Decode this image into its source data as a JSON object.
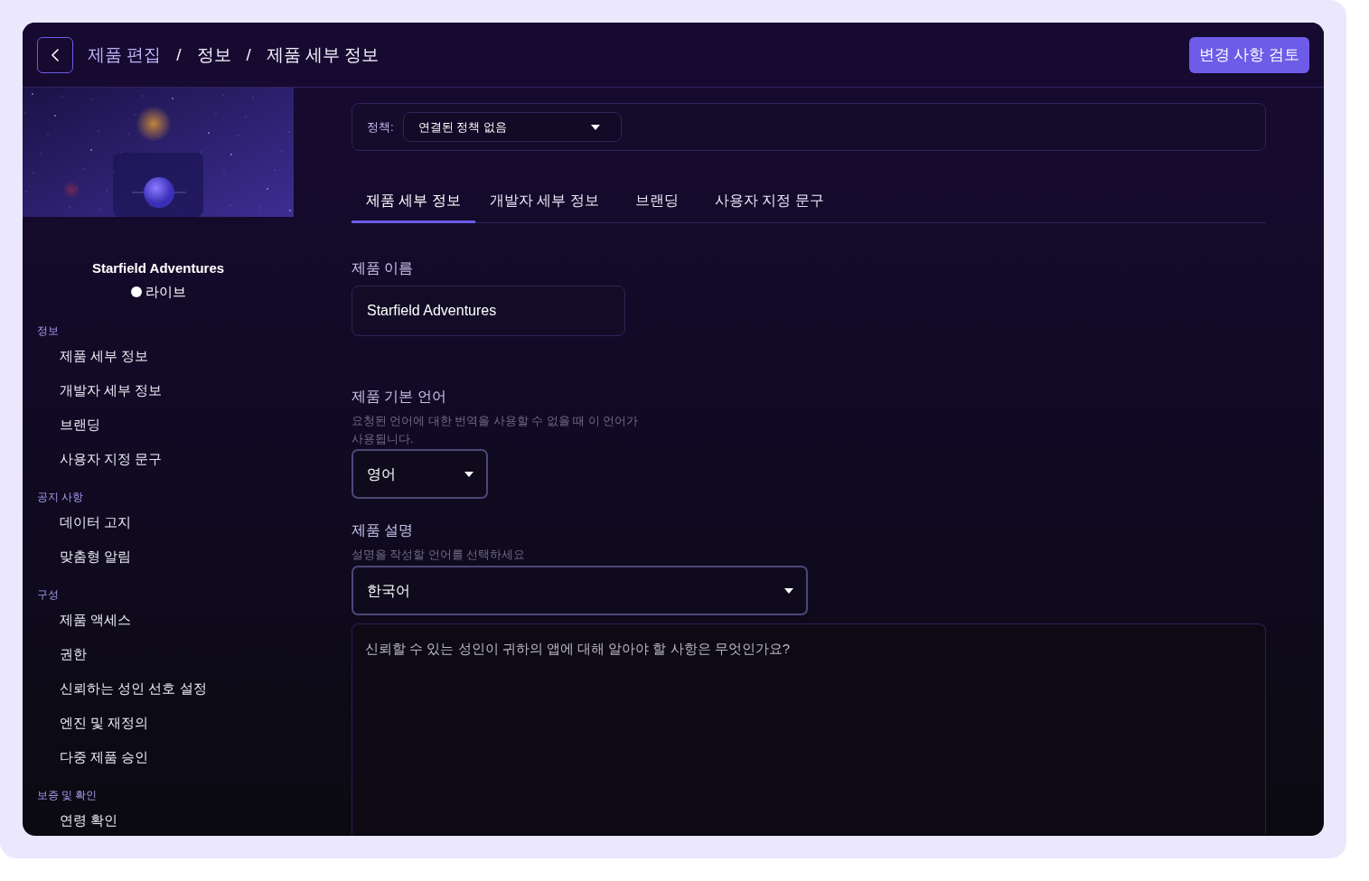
{
  "header": {
    "back_button": {
      "kind": "back"
    },
    "breadcrumb": [
      {
        "label": "제품 편집",
        "kind": "link"
      },
      {
        "label": "/",
        "kind": "separator"
      },
      {
        "label": "정보",
        "kind": "page"
      },
      {
        "label": "/",
        "kind": "separator"
      },
      {
        "label": "제품 세부 정보",
        "kind": "page"
      }
    ],
    "review_button": "변경 사항 검토"
  },
  "sidebar": {
    "product_name": "Starfield Adventures",
    "status": "라이브",
    "sections": [
      {
        "title": "정보",
        "items": [
          "제품 세부 정보",
          "개발자 세부 정보",
          "브랜딩",
          "사용자 지정 문구"
        ]
      },
      {
        "title": "공지 사항",
        "items": [
          "데이터 고지",
          "맞춤형 알림"
        ]
      },
      {
        "title": "구성",
        "items": [
          "제품 액세스",
          "권한",
          "신뢰하는 성인 선호 설정",
          "엔진 및 재정의",
          "다중 제품 승인"
        ]
      },
      {
        "title": "보증 및 확인",
        "items": [
          "연령 확인"
        ]
      }
    ]
  },
  "policy": {
    "label": "정책:",
    "value": "연결된 정책 없음"
  },
  "tabs": [
    {
      "label": "제품 세부 정보",
      "selected": true
    },
    {
      "label": "개발자 세부 정보",
      "selected": false
    },
    {
      "label": "브랜딩",
      "selected": false
    },
    {
      "label": "사용자 지정 문구",
      "selected": false
    }
  ],
  "fields": [
    {
      "kind": "text",
      "label": "제품 이름",
      "value": "Starfield Adventures"
    },
    {
      "kind": "select",
      "label": "제품 기본 언어",
      "help": "요청된 언어에 대한 번역을 사용할 수 없을 때 이 언어가 사용됩니다.",
      "value": "영어"
    },
    {
      "kind": "translated-text",
      "label": "제품 설명",
      "help": "설명을 작성할 언어를 선택하세요",
      "value": "한국어",
      "placeholder": "신뢰할 수 있는 성인이 귀하의 앱에 대해 알아야 할 사항은 무엇인가요?"
    }
  ]
}
